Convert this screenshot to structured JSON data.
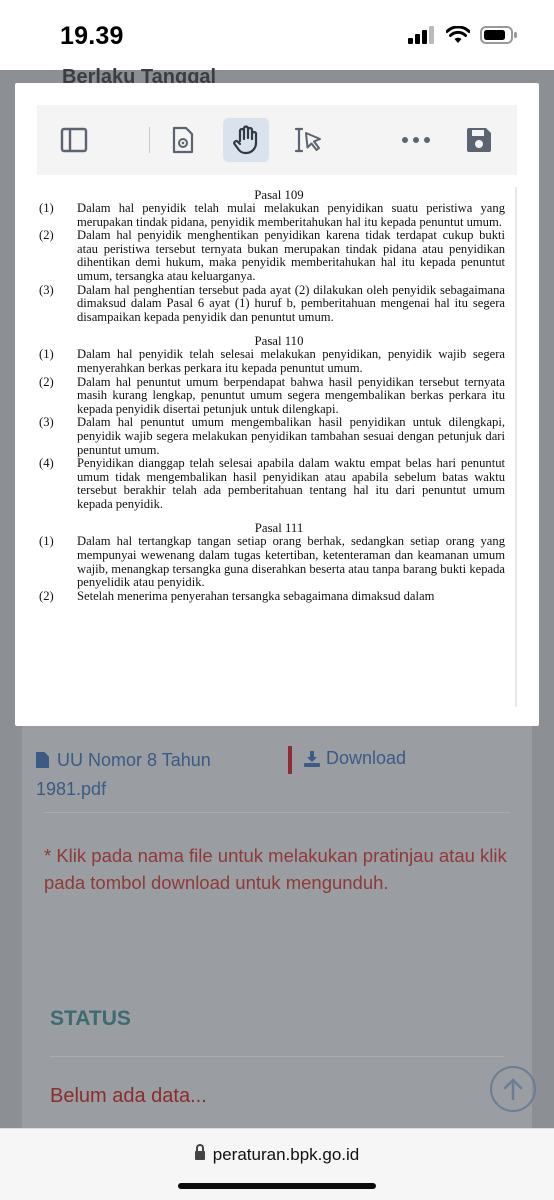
{
  "status_bar": {
    "time": "19.39"
  },
  "background_page": {
    "section_title": "Berlaku Tanggal",
    "file": {
      "name": "UU Nomor 8 Tahun 1981.pdf",
      "name_line1": "UU Nomor 8 Tahun",
      "name_line2": "1981.pdf"
    },
    "download_label": "Download",
    "note": "* Klik pada nama file untuk melakukan pratinjau atau klik pada tombol download untuk mengunduh.",
    "status": {
      "title": "STATUS",
      "empty": "Belum ada data..."
    }
  },
  "viewer": {
    "toolbar": [
      "sidebar-toggle",
      "document-properties",
      "hand-tool",
      "text-select-tool",
      "more-options",
      "save"
    ],
    "active_tool": "hand-tool",
    "pasal": [
      {
        "title": "Pasal 109",
        "items": [
          {
            "num": "(1)",
            "text": "Dalam hal penyidik telah mulai melakukan penyidikan suatu peristiwa yang merupakan tindak pidana, penyidik memberitahukan hal itu kepada penuntut umum."
          },
          {
            "num": "(2)",
            "text": "Dalam hal penyidik menghentikan penyidikan karena tidak terdapat cukup bukti atau peristiwa tersebut ternyata bukan merupakan tindak pidana atau penyidikan dihentikan demi hukum, maka penyidik memberitahukan hal itu kepada penuntut umum, tersangka atau keluarganya."
          },
          {
            "num": "(3)",
            "text": "Dalam hal penghentian tersebut pada ayat (2) dilakukan oleh penyidik sebagaimana dimaksud dalam Pasal 6 ayat (1) huruf b, pemberitahuan mengenai hal itu segera disampaikan kepada penyidik dan penuntut umum."
          }
        ]
      },
      {
        "title": "Pasal 110",
        "items": [
          {
            "num": "(1)",
            "text": "Dalam hal penyidik telah selesai melakukan penyidikan, penyidik wajib segera menyerahkan berkas perkara itu kepada penuntut umum."
          },
          {
            "num": "(2)",
            "text": "Dalam hal penuntut umum berpendapat bahwa hasil penyidikan tersebut ternyata masih kurang lengkap, penuntut umum segera mengembalikan berkas perkara itu kepada penyidik disertai petunjuk untuk dilengkapi."
          },
          {
            "num": "(3)",
            "text": "Dalam hal penuntut umum mengembalikan hasil penyidikan untuk dilengkapi, penyidik wajib segera melakukan penyidikan tambahan sesuai dengan petunjuk dari penuntut umum."
          },
          {
            "num": "(4)",
            "text": "Penyidikan dianggap telah selesai apabila dalam waktu empat belas hari penuntut umum tidak mengembalikan hasil penyidikan atau apabila sebelum batas waktu tersebut berakhir telah ada pemberitahuan tentang hal itu dari penuntut umum kepada penyidik."
          }
        ]
      },
      {
        "title": "Pasal 111",
        "items": [
          {
            "num": "(1)",
            "text": "Dalam hal tertangkap tangan setiap orang berhak, sedangkan setiap orang yang mempunyai wewenang dalam tugas ketertiban, ketenteraman dan keamanan umum wajib, menangkap tersangka guna diserahkan beserta atau tanpa barang bukti kepada penyelidik atau penyidik."
          },
          {
            "num": "(2)",
            "text": "Setelah menerima penyerahan tersangka sebagaimana dimaksud dalam"
          }
        ]
      }
    ]
  },
  "browser": {
    "url": "peraturan.bpk.go.id"
  }
}
